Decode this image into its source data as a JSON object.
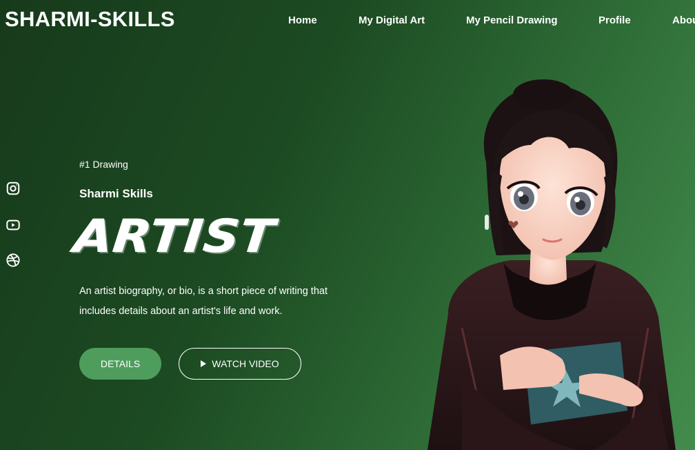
{
  "header": {
    "logo": "SHARMI-SKILLS",
    "nav": [
      "Home",
      "My Digital Art",
      "My Pencil Drawing",
      "Profile",
      "About"
    ]
  },
  "social": [
    "instagram-icon",
    "youtube-icon",
    "dribbble-icon"
  ],
  "hero": {
    "tag": "#1 Drawing",
    "name": "Sharmi Skills",
    "headline": "ARTIST",
    "bio_line1": "An artist biography, or bio, is a short piece of writing that",
    "bio_line2": "includes details about an artist's life and work.",
    "details_button": "DETAILS",
    "video_button": "WATCH VIDEO"
  },
  "colors": {
    "accent": "#4e9d5c",
    "background_dark": "#173a1b",
    "background_light": "#438c4d"
  }
}
